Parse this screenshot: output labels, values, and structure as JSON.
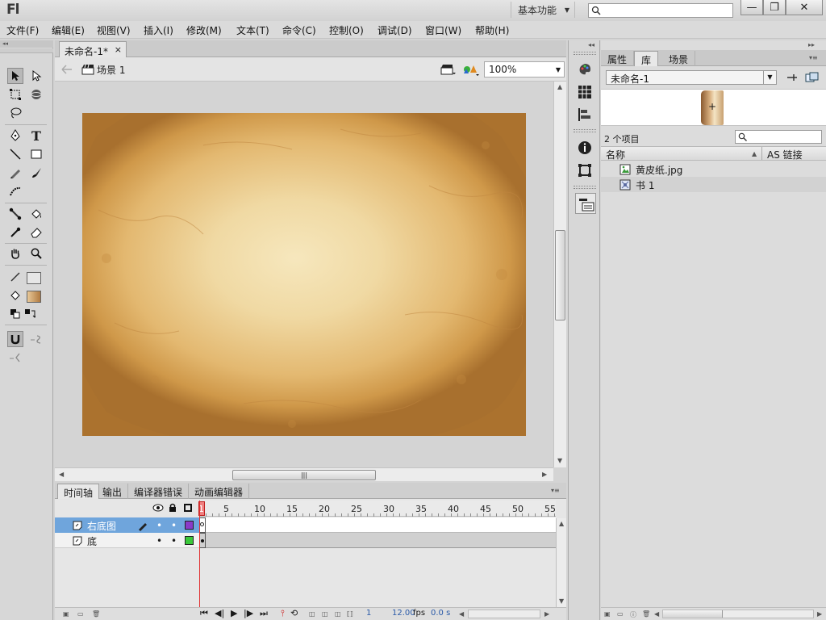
{
  "app": {
    "logo": "Fl",
    "workspace": "基本功能",
    "search_placeholder": ""
  },
  "window_buttons": {
    "minimize": "—",
    "restore": "❐",
    "close": "✕"
  },
  "menu": [
    "文件(F)",
    "编辑(E)",
    "视图(V)",
    "插入(I)",
    "修改(M)",
    "文本(T)",
    "命令(C)",
    "控制(O)",
    "调试(D)",
    "窗口(W)",
    "帮助(H)"
  ],
  "document": {
    "tab_title": "未命名-1*",
    "tab_close": "×",
    "scene": "场景 1",
    "zoom": "100%"
  },
  "tools": [
    {
      "name": "selection-tool-icon",
      "glyph": "➚"
    },
    {
      "name": "subselection-tool-icon",
      "glyph": "➶"
    },
    {
      "name": "free-transform-tool-icon",
      "glyph": "⬚"
    },
    {
      "name": "3d-rotation-tool-icon",
      "glyph": "◉"
    },
    {
      "name": "lasso-tool-icon",
      "glyph": "ᘐ"
    },
    {
      "name": "pen-tool-icon",
      "glyph": "✒"
    },
    {
      "name": "text-tool-icon",
      "glyph": "T"
    },
    {
      "name": "line-tool-icon",
      "glyph": "╲"
    },
    {
      "name": "rectangle-tool-icon",
      "glyph": "▭"
    },
    {
      "name": "pencil-tool-icon",
      "glyph": "✎"
    },
    {
      "name": "brush-tool-icon",
      "glyph": "🖌"
    },
    {
      "name": "deco-tool-icon",
      "glyph": "✿"
    },
    {
      "name": "bone-tool-icon",
      "glyph": "⟠"
    },
    {
      "name": "paint-bucket-tool-icon",
      "glyph": "◬"
    },
    {
      "name": "eyedropper-tool-icon",
      "glyph": "⁄"
    },
    {
      "name": "eraser-tool-icon",
      "glyph": "⌫"
    },
    {
      "name": "hand-tool-icon",
      "glyph": "✋"
    },
    {
      "name": "zoom-tool-icon",
      "glyph": "⚲"
    },
    {
      "name": "stroke-color-icon",
      "glyph": "✏"
    },
    {
      "name": "fill-color-icon",
      "glyph": "◈"
    },
    {
      "name": "default-colors-icon",
      "glyph": "◧"
    },
    {
      "name": "swap-colors-icon",
      "glyph": "⇄"
    },
    {
      "name": "snap-to-objects-icon",
      "glyph": "∩"
    },
    {
      "name": "smooth-icon",
      "glyph": "⤳"
    },
    {
      "name": "straighten-icon",
      "glyph": "⤷"
    }
  ],
  "colors": {
    "stroke": "#000000",
    "fill_gradient": "#c8965a",
    "layer_selected": "#6fa5dc",
    "layer1_outline": "#8a3ac8",
    "layer2_outline": "#3ac83a",
    "playhead": "#e03030"
  },
  "timeline": {
    "tabs": [
      "时间轴",
      "输出",
      "编译器错误",
      "动画编辑器"
    ],
    "ruler": [
      "1",
      "5",
      "10",
      "15",
      "20",
      "25",
      "30",
      "35",
      "40",
      "45",
      "50",
      "55"
    ],
    "layers": [
      {
        "name": "右底图",
        "selected": true,
        "color": "#8a3ac8"
      },
      {
        "name": "底",
        "selected": false,
        "color": "#3ac83a"
      }
    ],
    "footer": {
      "frame": "1",
      "fps_value": "12.00",
      "fps_unit": "fps",
      "time": "0.0 s"
    }
  },
  "panel": {
    "tabs": [
      "属性",
      "库",
      "场景"
    ],
    "library_doc": "未命名-1",
    "count": "2 个项目",
    "columns": {
      "name": "名称",
      "linkage": "AS 链接"
    },
    "items": [
      {
        "name": "黄皮纸.jpg",
        "icon": "bitmap-icon"
      },
      {
        "name": "书 1",
        "icon": "graphic-symbol-icon"
      }
    ]
  }
}
